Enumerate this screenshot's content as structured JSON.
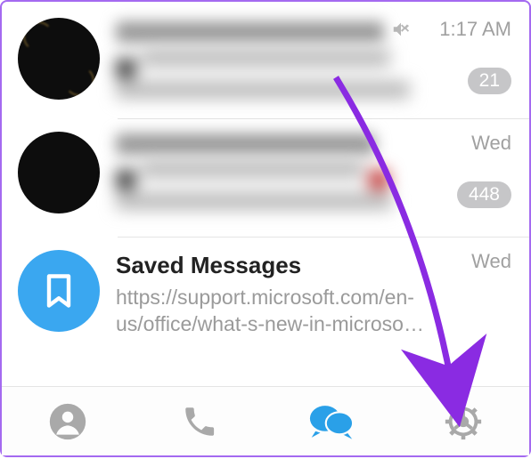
{
  "chats": [
    {
      "title": "████ ████ World ██ ..",
      "titleRedacted": true,
      "muted": true,
      "previewRedacted": true,
      "preview": "███ ████ ███? (████)\n██████: █████ █████. ██████..",
      "time": "1:17 AM",
      "badge": "21"
    },
    {
      "title": "████ ██████ █████",
      "titleRedacted": true,
      "muted": false,
      "previewRedacted": true,
      "preview": "████ ██ ██ ████████\n███ ████ ██ ██████████d_..",
      "time": "Wed",
      "badge": "448"
    },
    {
      "title": "Saved Messages",
      "titleRedacted": false,
      "muted": false,
      "previewRedacted": false,
      "preview": "https://support.microsoft.com/en-us/office/what-s-new-in-microso…",
      "time": "Wed",
      "badge": ""
    }
  ],
  "nav": {
    "contacts": "Contacts",
    "calls": "Calls",
    "chats": "Chats",
    "settings": "Settings"
  },
  "colors": {
    "accent": "#2aa0e8",
    "arrow": "#8a2be2"
  }
}
